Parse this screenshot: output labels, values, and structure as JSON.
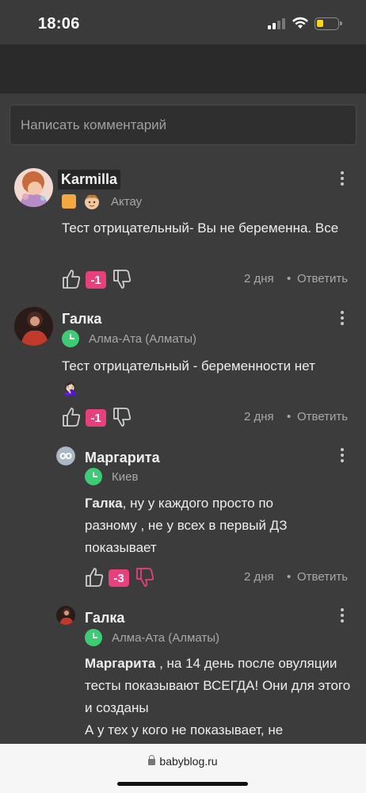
{
  "status_bar": {
    "time": "18:06"
  },
  "input": {
    "placeholder": "Написать комментарий"
  },
  "comments": [
    {
      "author": "Karmilla",
      "location": "Актау",
      "text": "Тест отрицательный- Вы не беременна. Все",
      "score": "-1",
      "time_ago": "2 дня",
      "reply_label": "Ответить"
    },
    {
      "author": "Галка",
      "location": "Алма-Ата (Алматы)",
      "text": "Тест отрицательный - беременности нет",
      "emoji": "🤦🏻‍♀️",
      "score": "-1",
      "time_ago": "2 дня",
      "reply_label": "Ответить"
    },
    {
      "author": "Маргарита",
      "location": "Киев",
      "mention": "Галка",
      "text": ", ну у каждого просто по разному , не у всех в первый ДЗ показывает",
      "score": "-3",
      "time_ago": "2 дня",
      "reply_label": "Ответить"
    },
    {
      "author": "Галка",
      "location": "Алма-Ата (Алматы)",
      "mention": "Маргарита",
      "text": " , на 14 день после овуляции тесты показывают ВСЕГДА! Они для этого и созданы",
      "text2": "А у тех у кого не показывает, не"
    }
  ],
  "dot_separator": "•",
  "browser": {
    "url": "babyblog.ru"
  },
  "colors": {
    "score_badge": "#e8407c",
    "location_clock": "#3ecb76",
    "badge": "#f5a742"
  }
}
